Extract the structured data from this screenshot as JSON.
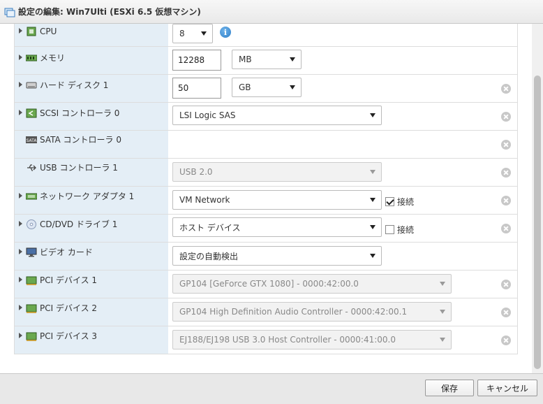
{
  "window": {
    "title": "設定の編集: Win7Ulti (ESXi 6.5 仮想マシン)"
  },
  "rows": [
    {
      "label": "CPU",
      "icon": "cpu-icon",
      "value": "8"
    },
    {
      "label": "メモリ",
      "icon": "memory-icon",
      "value": "12288",
      "unit": "MB"
    },
    {
      "label": "ハード ディスク 1",
      "icon": "hard-disk-icon",
      "value": "50",
      "unit": "GB"
    },
    {
      "label": "SCSI コントローラ 0",
      "icon": "scsi-controller-icon",
      "value": "LSI Logic SAS"
    },
    {
      "label": "SATA コントローラ 0",
      "icon": "sata-controller-icon"
    },
    {
      "label": "USB コントローラ 1",
      "icon": "usb-controller-icon",
      "value": "USB 2.0"
    },
    {
      "label": "ネットワーク アダプタ 1",
      "icon": "network-adapter-icon",
      "value": "VM Network",
      "checkbox_label": "接続",
      "connected": true
    },
    {
      "label": "CD/DVD ドライブ 1",
      "icon": "cd-dvd-icon",
      "value": "ホスト デバイス",
      "checkbox_label": "接続",
      "connected": false
    },
    {
      "label": "ビデオ カード",
      "icon": "video-card-icon",
      "value": "設定の自動検出"
    },
    {
      "label": "PCI デバイス 1",
      "icon": "pci-device-icon",
      "value": "GP104 [GeForce GTX 1080] - 0000:42:00.0"
    },
    {
      "label": "PCI デバイス 2",
      "icon": "pci-device-icon",
      "value": "GP104 High Definition Audio Controller - 0000:42:00.1"
    },
    {
      "label": "PCI デバイス 3",
      "icon": "pci-device-icon",
      "value": "EJ188/EJ198 USB 3.0 Host Controller - 0000:41:00.0"
    }
  ],
  "footer": {
    "save_label": "保存",
    "cancel_label": "キャンセル"
  },
  "colors": {
    "label_bg": "#e4eef6",
    "accent": "#2f7fc8"
  }
}
